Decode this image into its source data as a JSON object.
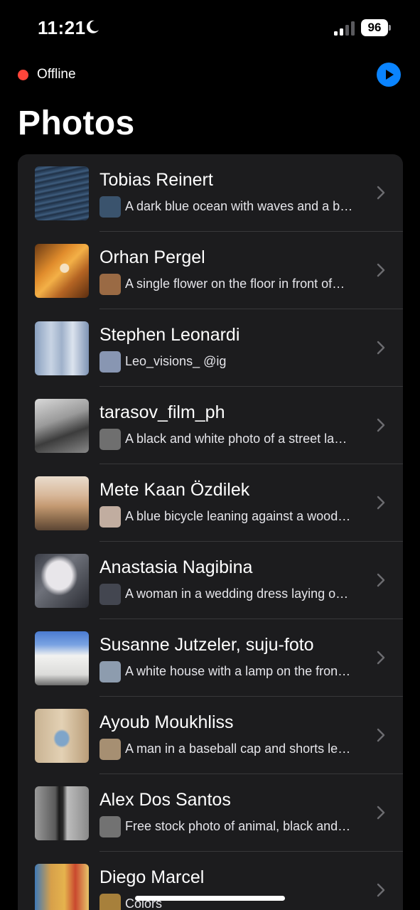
{
  "status_bar": {
    "time": "11:21",
    "battery": "96"
  },
  "header": {
    "status_label": "Offline",
    "status_color": "#ff453a",
    "accent_color": "#0a84ff",
    "play_icon": "play-circle-icon",
    "title": "Photos"
  },
  "rows": [
    {
      "title": "Tobias Reinert",
      "subtitle": "A dark blue ocean with waves and a b…",
      "color": "#3a536d"
    },
    {
      "title": "Orhan Pergel",
      "subtitle": "A single flower on the floor in front of…",
      "color": "#9a6a44"
    },
    {
      "title": "Stephen Leonardi",
      "subtitle": "Leo_visions_   @ig",
      "color": "#8896b2"
    },
    {
      "title": "tarasov_film_ph",
      "subtitle": "A black and white photo of a street la…",
      "color": "#6f6f6f"
    },
    {
      "title": "Mete Kaan Özdilek",
      "subtitle": "A blue bicycle leaning against a wood…",
      "color": "#c1ada0"
    },
    {
      "title": "Anastasia Nagibina",
      "subtitle": "A woman in a wedding dress laying o…",
      "color": "#434650"
    },
    {
      "title": "Susanne Jutzeler, suju-foto",
      "subtitle": "A white house with a lamp on the fron…",
      "color": "#8d9cae"
    },
    {
      "title": "Ayoub Moukhliss",
      "subtitle": "A man in a baseball cap and shorts le…",
      "color": "#a68f72"
    },
    {
      "title": "Alex Dos Santos",
      "subtitle": "Free stock photo of animal, black and…",
      "color": "#727272"
    },
    {
      "title": "Diego Marcel",
      "subtitle": "Colors",
      "color": "#a7803b"
    }
  ]
}
